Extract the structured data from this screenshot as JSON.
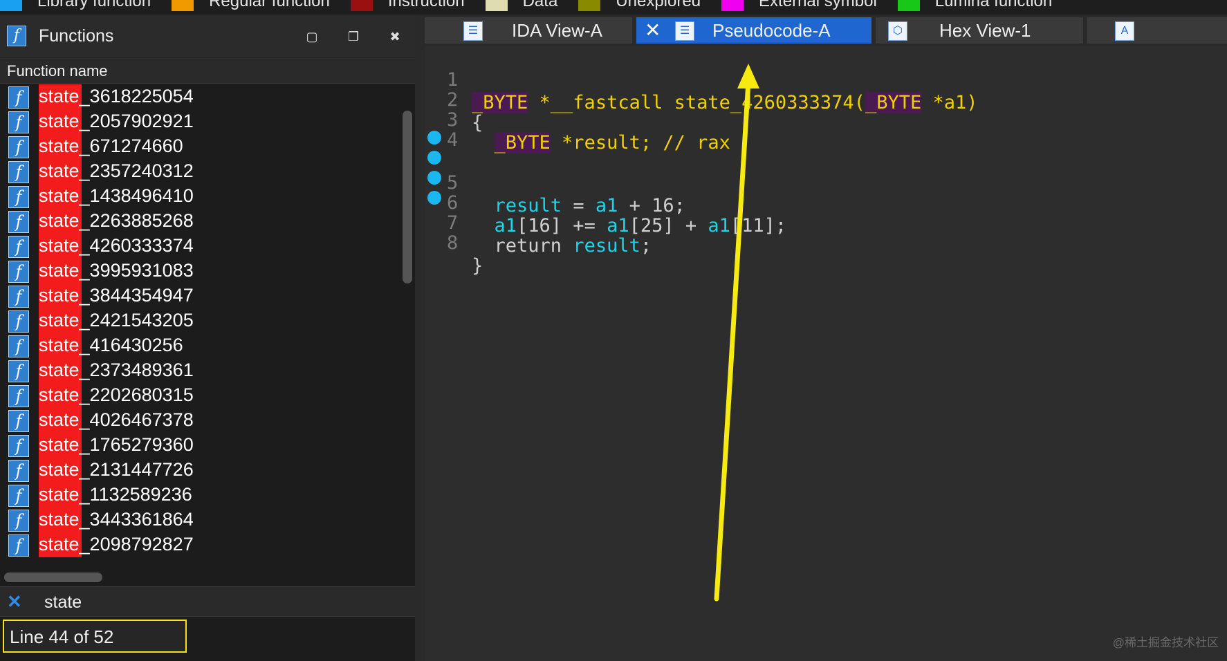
{
  "legend": [
    {
      "label": "Library function",
      "color": "#1aa0f0"
    },
    {
      "label": "Regular function",
      "color": "#f09a00"
    },
    {
      "label": "Instruction",
      "color": "#9a0f0f"
    },
    {
      "label": "Data",
      "color": "#dedcb0"
    },
    {
      "label": "Unexplored",
      "color": "#8a8a00"
    },
    {
      "label": "External symbol",
      "color": "#f000f0"
    },
    {
      "label": "Lumina function",
      "color": "#18c818"
    }
  ],
  "functions_panel": {
    "title": "Functions",
    "column_header": "Function name",
    "items": [
      "state_3618225054",
      "state_2057902921",
      "state_671274660",
      "state_2357240312",
      "state_1438496410",
      "state_2263885268",
      "state_4260333374",
      "state_3995931083",
      "state_3844354947",
      "state_2421543205",
      "state_416430256",
      "state_2373489361",
      "state_2202680315",
      "state_4026467378",
      "state_1765279360",
      "state_2131447726",
      "state_1132589236",
      "state_3443361864",
      "state_2098792827"
    ],
    "filter_text": "state",
    "status_text": "Line 44 of 52"
  },
  "tabs": [
    {
      "label": "IDA View-A",
      "active": false
    },
    {
      "label": "Pseudocode-A",
      "active": true
    },
    {
      "label": "Hex View-1",
      "active": false
    }
  ],
  "code": {
    "line_numbers": [
      "1",
      "2",
      "3",
      "4",
      "5",
      "6",
      "7",
      "8"
    ],
    "l1_type": "_BYTE",
    "l1_rest": " *__fastcall state_4260333374(",
    "l1_type2": "_BYTE",
    "l1_end": " *a1)",
    "l2": "{",
    "l3_type": "_BYTE",
    "l3_rest": " *result; // rax",
    "l5_var": "result",
    "l5_mid": " = ",
    "l5_var2": "a1",
    "l5_end": " + 16;",
    "l6_var": "a1",
    "l6_mid": "[16] += ",
    "l6_var2": "a1",
    "l6_mid2": "[25] + ",
    "l6_var3": "a1",
    "l6_end": "[11];",
    "l7_kw": "return",
    "l7_var": " result",
    "l7_end": ";",
    "l8": "}"
  },
  "watermark": "@稀土掘金技术社区"
}
